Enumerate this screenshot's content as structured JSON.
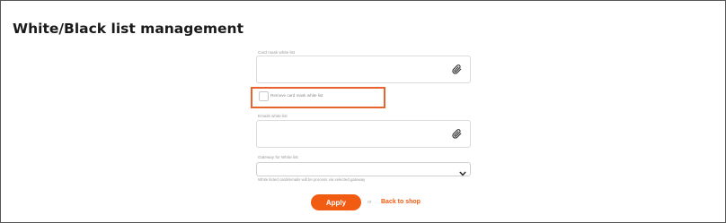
{
  "page": {
    "title": "White/Black list management"
  },
  "form": {
    "card_mask_white_list": {
      "label": "Card mask white list",
      "value": ""
    },
    "remove_card_mask": {
      "label": "Remove card mask white list",
      "checked": false
    },
    "emails_white_list": {
      "label": "Emails white list",
      "value": ""
    },
    "gateway": {
      "label": "Gateway for White list",
      "selected": "",
      "hint": "White listed cardi/emails will be process via selected gateway"
    }
  },
  "actions": {
    "apply_label": "Apply",
    "or_label": "or",
    "back_label": "Back to shop"
  },
  "colors": {
    "accent": "#f25b12",
    "highlight": "#e8642c"
  },
  "icons": {
    "attach": "paperclip-icon",
    "dropdown": "chevron-down-icon"
  }
}
